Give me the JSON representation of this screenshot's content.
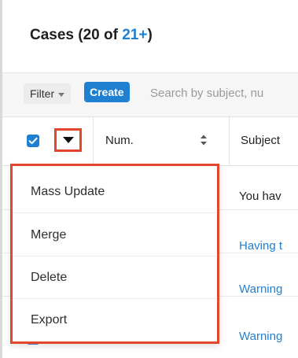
{
  "header": {
    "title": "Cases",
    "count_open": "(20 of ",
    "count_link": "21+",
    "count_close": ")"
  },
  "toolbar": {
    "filter_label": "Filter",
    "create_label": "Create",
    "search_placeholder": "Search by subject, nu"
  },
  "table": {
    "columns": [
      {
        "label": "Num."
      },
      {
        "label": "Subject"
      }
    ],
    "rows": [
      {
        "subject": "You hav",
        "style": "plain"
      },
      {
        "subject": "Having t",
        "style": "link"
      },
      {
        "subject": "Warning",
        "style": "link"
      },
      {
        "subject": "Warning",
        "style": "link"
      }
    ]
  },
  "actions_menu": {
    "items": [
      {
        "label": "Mass Update"
      },
      {
        "label": "Merge"
      },
      {
        "label": "Delete"
      },
      {
        "label": "Export"
      }
    ]
  },
  "colors": {
    "accent": "#1f7fd0",
    "highlight": "#e5452b"
  },
  "icons": {
    "filter_caret": "caret-down-icon",
    "select_all": "checkbox-checked-icon",
    "actions": "caret-down-icon",
    "sort": "sort-icon"
  }
}
